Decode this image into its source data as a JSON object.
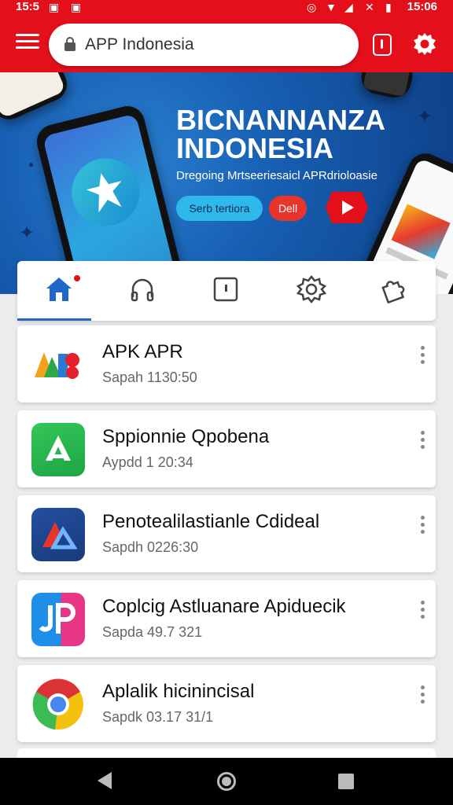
{
  "status_bar": {
    "time_left": "15:5",
    "time_right": "15:06"
  },
  "toolbar": {
    "menu_icon": "hamburger-icon",
    "address": "APP Indonesia",
    "lock_icon": "lock-icon",
    "tabs_icon": "tabs-icon",
    "settings_icon": "gear-icon",
    "accent_color": "#e3101b"
  },
  "banner": {
    "title_line1": "BICNANNANZA",
    "title_line2": "INDONESIA",
    "subtitle": "Dregoing Mrtseeriesaicl APRdrioloasie",
    "button_primary": "Serb tertiora",
    "button_secondary": "Dell",
    "play_icon": "youtube-play-icon"
  },
  "categories": [
    {
      "icon": "home-icon",
      "active": true
    },
    {
      "icon": "headphones-icon",
      "active": false
    },
    {
      "icon": "door-icon",
      "active": false
    },
    {
      "icon": "settings-gear-icon",
      "active": false
    },
    {
      "icon": "puzzle-icon",
      "active": false
    }
  ],
  "apps": [
    {
      "name": "APK APR",
      "meta": "Sapah 1130:50",
      "icon": "apr-logo-icon"
    },
    {
      "name": "Sppionnie Qpobena",
      "meta": "Aypdd 1 20:34",
      "icon": "app-store-icon"
    },
    {
      "name": "Penotealilastianle Cdideal",
      "meta": "Sapdh 0226:30",
      "icon": "triangle-logo-icon"
    },
    {
      "name": "Coplcig Astluanare Apiduecik",
      "meta": "Sapda 49.7 321",
      "icon": "jp-logo-icon"
    },
    {
      "name": "Aplalik hicinincisal",
      "meta": "Sapdk 03.17 31/1",
      "icon": "chrome-icon"
    }
  ],
  "nav_bar": {
    "back_icon": "back-icon",
    "home_icon": "home-circle-icon",
    "recent_icon": "recent-apps-icon"
  }
}
